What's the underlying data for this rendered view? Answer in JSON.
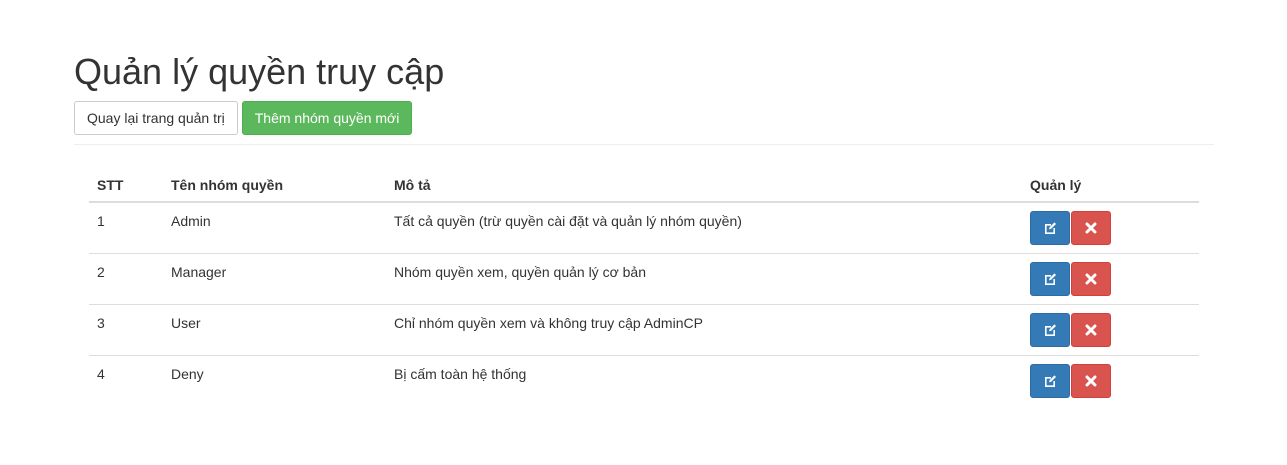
{
  "page": {
    "title": "Quản lý quyền truy cập"
  },
  "toolbar": {
    "back_label": "Quay lại trang quản trị",
    "add_label": "Thêm nhóm quyền mới"
  },
  "table": {
    "headers": {
      "stt": "STT",
      "name": "Tên nhóm quyền",
      "desc": "Mô tả",
      "manage": "Quản lý"
    },
    "rows": [
      {
        "stt": "1",
        "name": "Admin",
        "desc": "Tất cả quyền (trừ quyền cài đặt và quản lý nhóm quyền)"
      },
      {
        "stt": "2",
        "name": "Manager",
        "desc": "Nhóm quyền xem, quyền quản lý cơ bản"
      },
      {
        "stt": "3",
        "name": "User",
        "desc": "Chỉ nhóm quyền xem và không truy cập AdminCP"
      },
      {
        "stt": "4",
        "name": "Deny",
        "desc": "Bị cấm toàn hệ thống"
      }
    ],
    "row_actions": {
      "edit_icon": "edit-icon",
      "delete_icon": "close-icon"
    }
  },
  "colors": {
    "primary": "#337ab7",
    "danger": "#d9534f",
    "success": "#5cb85c"
  }
}
